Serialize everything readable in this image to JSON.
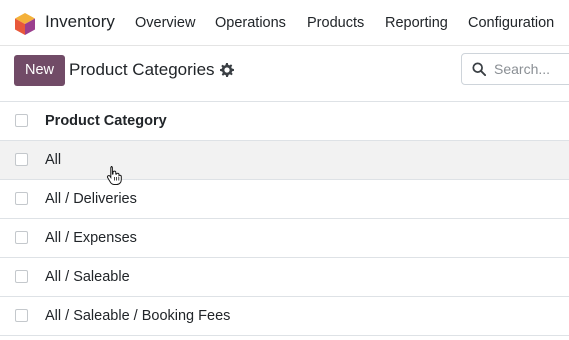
{
  "app": {
    "name": "Inventory",
    "logo_icon": "odoo-inventory-logo-icon",
    "logo_colors": [
      "#f2a32c",
      "#e0503a",
      "#8b3a8f"
    ]
  },
  "menu": {
    "items": [
      {
        "label": "Overview"
      },
      {
        "label": "Operations"
      },
      {
        "label": "Products"
      },
      {
        "label": "Reporting"
      },
      {
        "label": "Configuration"
      }
    ]
  },
  "control_panel": {
    "new_button_label": "New",
    "title": "Product Categories",
    "actions_icon": "gear-icon",
    "search_placeholder": "Search...",
    "search_icon": "search-icon",
    "accent_color": "#714b67"
  },
  "list": {
    "header": {
      "column_label": "Product Category"
    },
    "rows": [
      {
        "name": "All"
      },
      {
        "name": "All / Deliveries"
      },
      {
        "name": "All / Expenses"
      },
      {
        "name": "All / Saleable"
      },
      {
        "name": "All / Saleable / Booking Fees"
      }
    ]
  },
  "pointer_icon": "hand-pointer-cursor-icon"
}
